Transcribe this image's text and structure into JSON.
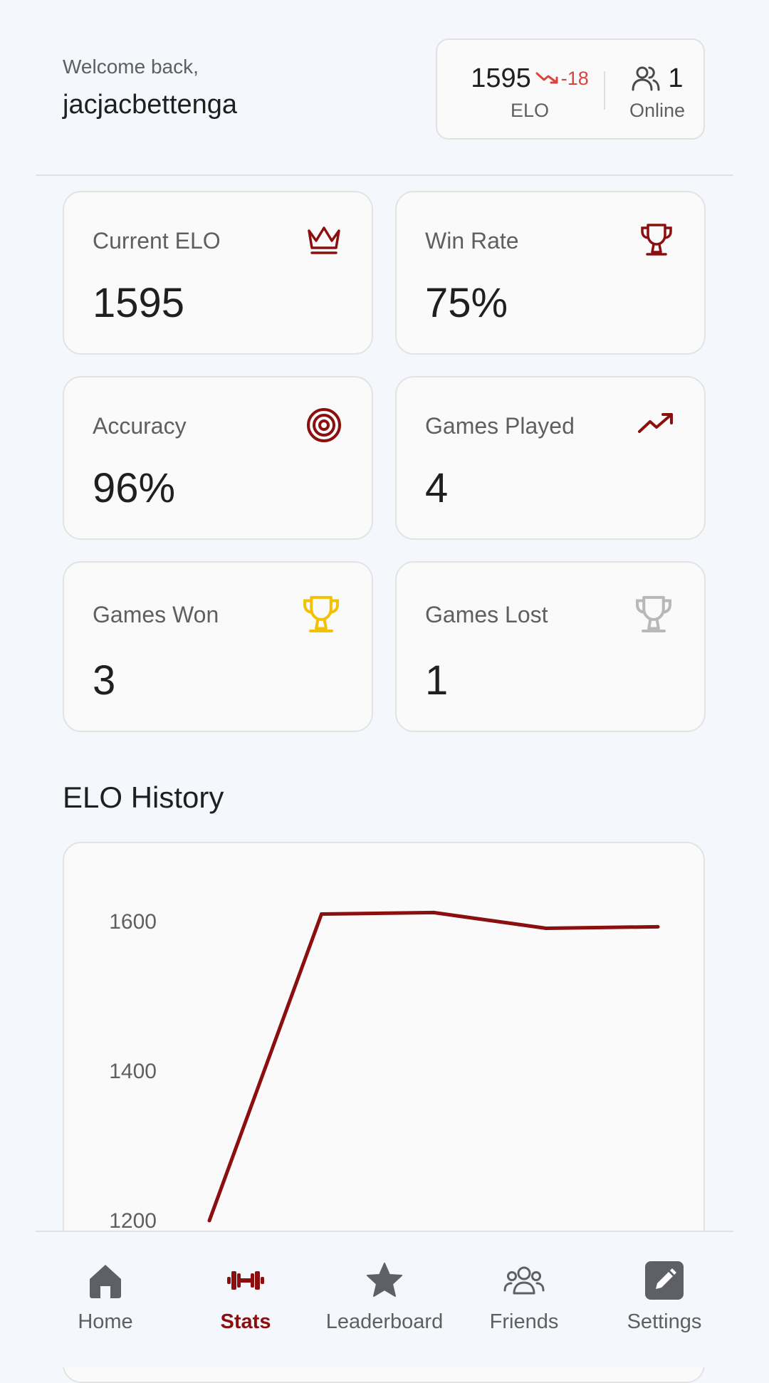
{
  "header": {
    "welcome": "Welcome back,",
    "username": "jacjacbettenga",
    "elo_value": "1595",
    "elo_delta": "-18",
    "elo_label": "ELO",
    "online_count": "1",
    "online_label": "Online"
  },
  "stats": [
    {
      "label": "Current ELO",
      "value": "1595",
      "icon": "crown-icon",
      "color": "#8b0f0f"
    },
    {
      "label": "Win Rate",
      "value": "75%",
      "icon": "trophy-icon",
      "color": "#8b0f0f"
    },
    {
      "label": "Accuracy",
      "value": "96%",
      "icon": "target-icon",
      "color": "#8b0f0f"
    },
    {
      "label": "Games Played",
      "value": "4",
      "icon": "trending-up-icon",
      "color": "#8b0f0f"
    },
    {
      "label": "Games Won",
      "value": "3",
      "icon": "trophy-icon",
      "color": "#f2c200"
    },
    {
      "label": "Games Lost",
      "value": "1",
      "icon": "trophy-icon",
      "color": "#b8b8b8"
    }
  ],
  "section_title": "ELO History",
  "chart_data": {
    "type": "line",
    "title": "",
    "xlabel": "",
    "ylabel": "",
    "y_ticks": [
      1600,
      1400,
      1200
    ],
    "ylim": [
      1200,
      1600
    ],
    "values": [
      1200,
      1610,
      1612,
      1591,
      1593
    ],
    "line_color": "#8b0f0f"
  },
  "nav": [
    {
      "label": "Home",
      "icon": "home-icon",
      "active": false
    },
    {
      "label": "Stats",
      "icon": "dumbbell-icon",
      "active": true
    },
    {
      "label": "Leaderboard",
      "icon": "star-icon",
      "active": false
    },
    {
      "label": "Friends",
      "icon": "users-icon",
      "active": false
    },
    {
      "label": "Settings",
      "icon": "edit-icon",
      "active": false
    }
  ],
  "colors": {
    "accent": "#8b0f0f",
    "delta_negative": "#d8453d",
    "inactive_nav": "#5f5f5f"
  }
}
